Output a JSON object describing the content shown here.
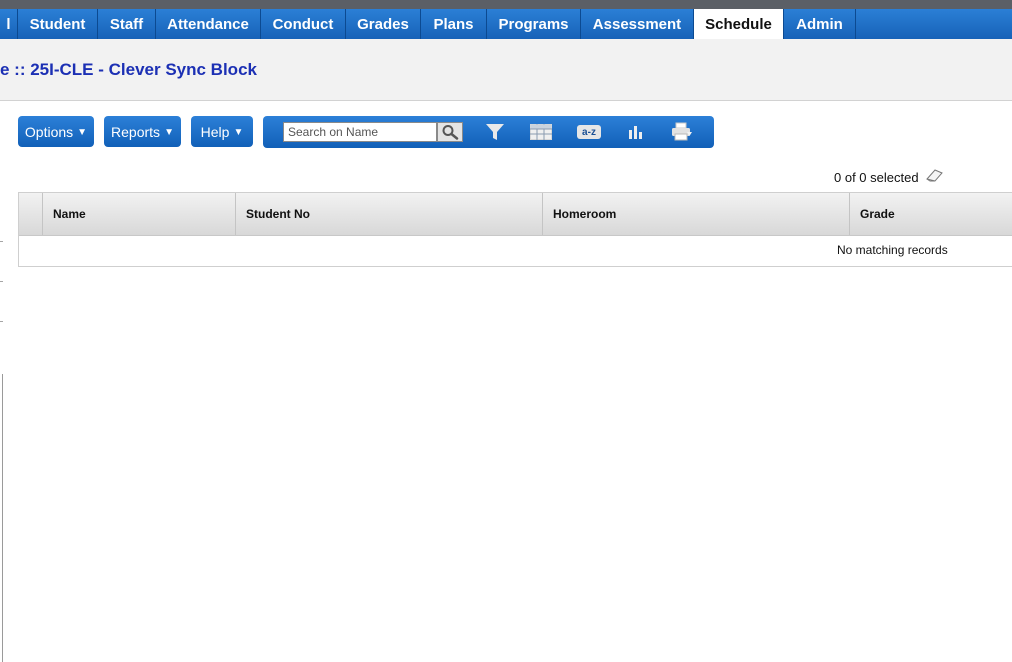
{
  "nav": {
    "tabs": [
      {
        "label": "l"
      },
      {
        "label": "Student"
      },
      {
        "label": "Staff"
      },
      {
        "label": "Attendance"
      },
      {
        "label": "Conduct"
      },
      {
        "label": "Grades"
      },
      {
        "label": "Plans"
      },
      {
        "label": "Programs"
      },
      {
        "label": "Assessment"
      },
      {
        "label": "Schedule",
        "active": true
      },
      {
        "label": "Admin"
      }
    ],
    "colors": {
      "bar": "#1762b8",
      "active_bg": "#ffffff"
    }
  },
  "header": {
    "title": "e :: 25I-CLE - Clever Sync Block",
    "title_color": "#1c30b4"
  },
  "actions": {
    "options_label": "Options",
    "reports_label": "Reports",
    "help_label": "Help"
  },
  "search": {
    "placeholder": "Search on Name",
    "value": ""
  },
  "toolbar_icons": [
    "search-icon",
    "filter-icon",
    "grid-icon",
    "sort-az-icon",
    "chart-icon",
    "print-icon"
  ],
  "toolbar_labels": {
    "sort": "a-z"
  },
  "selection": {
    "count_text": "0 of 0 selected"
  },
  "table": {
    "columns": [
      "Name",
      "Student No",
      "Homeroom",
      "Grade"
    ],
    "empty_message": "No matching records"
  }
}
